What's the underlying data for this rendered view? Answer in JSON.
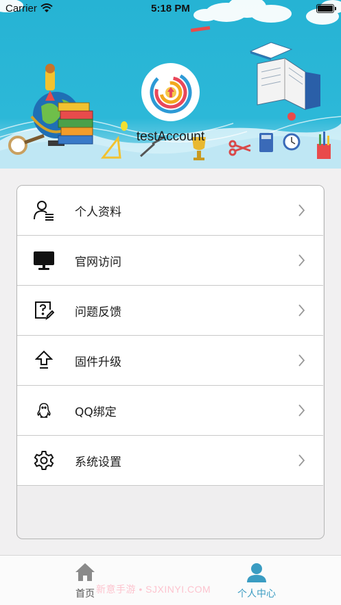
{
  "status_bar": {
    "carrier": "Carrier",
    "time": "5:18 PM"
  },
  "profile": {
    "username": "testAccount",
    "avatar_icon": "circular-arrow-logo-icon"
  },
  "menu": {
    "items": [
      {
        "label": "个人资料",
        "icon": "user-profile-icon"
      },
      {
        "label": "官网访问",
        "icon": "monitor-icon"
      },
      {
        "label": "问题反馈",
        "icon": "feedback-edit-icon"
      },
      {
        "label": "固件升级",
        "icon": "upload-arrow-icon"
      },
      {
        "label": "QQ绑定",
        "icon": "qq-penguin-icon"
      },
      {
        "label": "系统设置",
        "icon": "gear-icon"
      }
    ]
  },
  "tabbar": {
    "home_label": "首页",
    "me_label": "个人中心",
    "active_color": "#3a9cc2"
  },
  "watermark": "新意手游 • SJXINYI.COM",
  "colors": {
    "header_bg": "#2cb8d8",
    "accent": "#3a9cc2"
  }
}
